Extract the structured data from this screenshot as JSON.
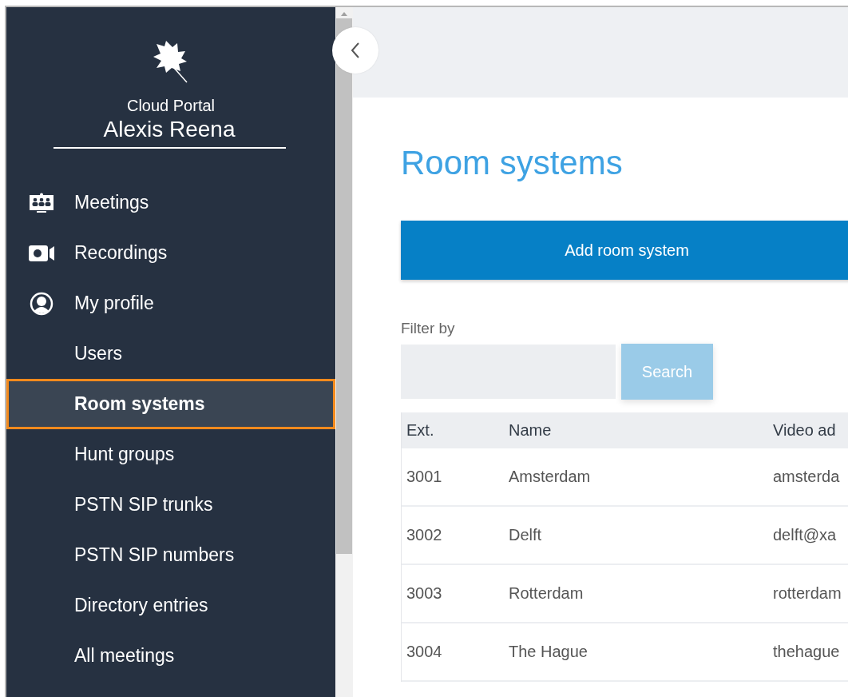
{
  "sidebar": {
    "brand": "Cloud Portal",
    "user": "Alexis Reena",
    "items": [
      {
        "label": "Meetings",
        "kind": "icon",
        "selected": false
      },
      {
        "label": "Recordings",
        "kind": "icon",
        "selected": false
      },
      {
        "label": "My profile",
        "kind": "icon",
        "selected": false
      },
      {
        "label": "Users",
        "selected": false
      },
      {
        "label": "Room systems",
        "selected": true
      },
      {
        "label": "Hunt groups",
        "selected": false
      },
      {
        "label": "PSTN SIP trunks",
        "selected": false
      },
      {
        "label": "PSTN SIP numbers",
        "selected": false
      },
      {
        "label": "Directory entries",
        "selected": false
      },
      {
        "label": "All meetings",
        "selected": false
      }
    ]
  },
  "content": {
    "title": "Room systems",
    "add_button": "Add room system",
    "filter": {
      "label": "Filter by",
      "button": "Search"
    },
    "table": {
      "columns": [
        "Ext.",
        "Name",
        "Video ad"
      ],
      "rows": [
        [
          "3001",
          "Amsterdam",
          "amsterda"
        ],
        [
          "3002",
          "Delft",
          "delft@xa"
        ],
        [
          "3003",
          "Rotterdam",
          "rotterdam"
        ],
        [
          "3004",
          "The Hague",
          "thehague"
        ]
      ]
    }
  }
}
